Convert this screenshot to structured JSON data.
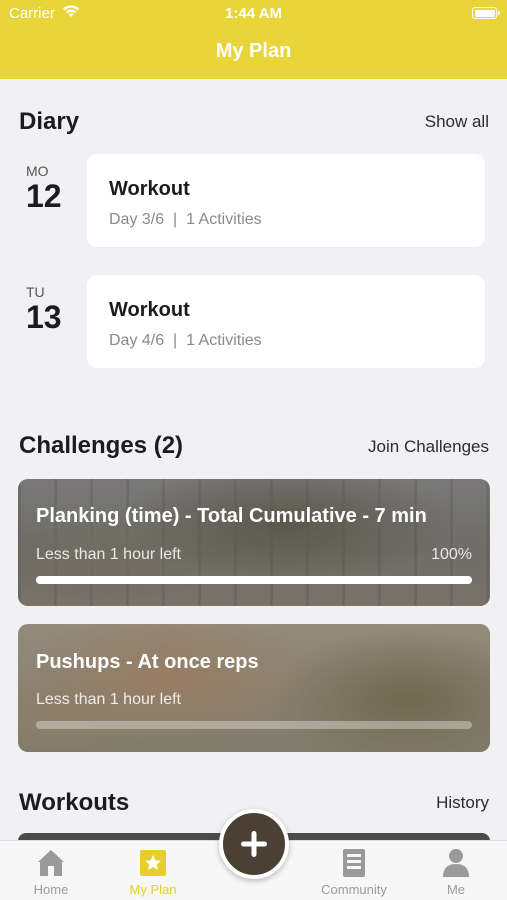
{
  "status_bar": {
    "carrier": "Carrier",
    "time": "1:44 AM"
  },
  "nav": {
    "title": "My Plan"
  },
  "diary": {
    "title": "Diary",
    "show_all": "Show all",
    "entries": [
      {
        "dow": "MO",
        "day": "12",
        "title": "Workout",
        "subtitle": "Day 3/6  |  1 Activities"
      },
      {
        "dow": "TU",
        "day": "13",
        "title": "Workout",
        "subtitle": "Day 4/6  |  1 Activities"
      }
    ]
  },
  "challenges": {
    "title": "Challenges (2)",
    "join": "Join Challenges",
    "items": [
      {
        "title": "Planking (time) - Total Cumulative - 7 min",
        "time_left": "Less than 1 hour left",
        "percent_label": "100%",
        "progress": 1.0
      },
      {
        "title": "Pushups - At once reps",
        "time_left": "Less than 1 hour left",
        "percent_label": "",
        "progress": 0.0
      }
    ]
  },
  "workouts": {
    "title": "Workouts",
    "history": "History"
  },
  "tabbar": {
    "items": [
      {
        "label": "Home",
        "icon": "home-icon"
      },
      {
        "label": "My Plan",
        "icon": "star-icon"
      },
      {
        "label": "Community",
        "icon": "book-icon"
      },
      {
        "label": "Me",
        "icon": "person-icon"
      }
    ],
    "add_icon": "plus-icon"
  },
  "colors": {
    "accent": "#e8d53a",
    "fab": "#4a4034",
    "active_tab": "#e6cf2c"
  }
}
